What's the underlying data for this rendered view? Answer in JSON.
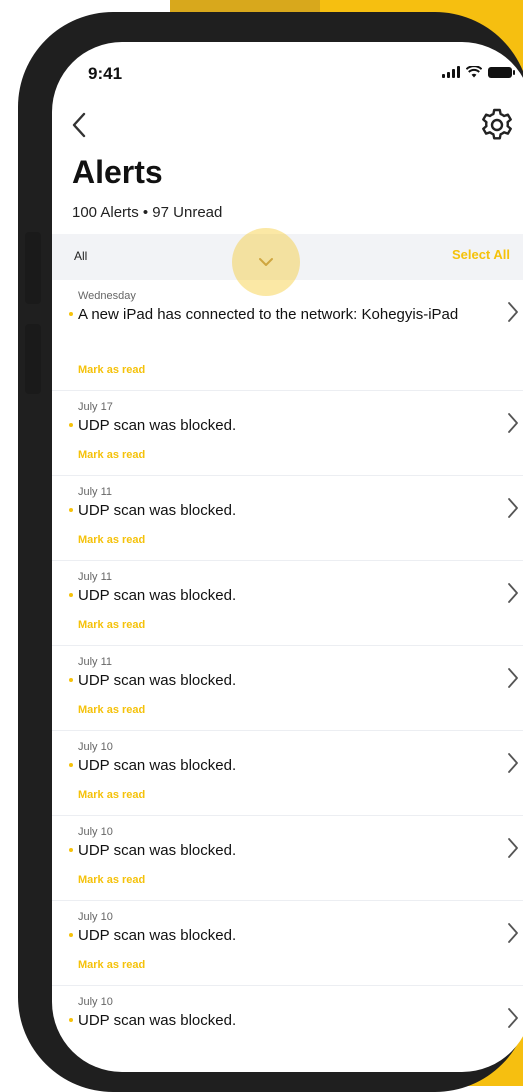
{
  "status_bar": {
    "time": "9:41"
  },
  "header": {
    "title": "Alerts",
    "subtitle": "100 Alerts • 97 Unread"
  },
  "filter": {
    "label": "All",
    "select_all": "Select All"
  },
  "alerts": [
    {
      "date": "Wednesday",
      "message": "A new iPad has connected to the network: Kohegyis-iPad",
      "action": "Mark as read"
    },
    {
      "date": "July 17",
      "message": "UDP scan was blocked.",
      "action": "Mark as read"
    },
    {
      "date": "July 11",
      "message": "UDP scan was blocked.",
      "action": "Mark as read"
    },
    {
      "date": "July 11",
      "message": "UDP scan was blocked.",
      "action": "Mark as read"
    },
    {
      "date": "July 11",
      "message": "UDP scan was blocked.",
      "action": "Mark as read"
    },
    {
      "date": "July 10",
      "message": "UDP scan was blocked.",
      "action": "Mark as read"
    },
    {
      "date": "July 10",
      "message": "UDP scan was blocked.",
      "action": "Mark as read"
    },
    {
      "date": "July 10",
      "message": "UDP scan was blocked.",
      "action": "Mark as read"
    },
    {
      "date": "July 10",
      "message": "UDP scan was blocked.",
      "action": ""
    }
  ],
  "colors": {
    "accent": "#f5c20b",
    "background_yellow": "#f6bf10",
    "phone_frame": "#1f1f1f",
    "filter_bar": "#f2f3f6"
  },
  "icons": {
    "back": "back-chevron-icon",
    "settings": "gear-icon",
    "filter": "chevron-down-icon",
    "row": "chevron-right-icon"
  }
}
